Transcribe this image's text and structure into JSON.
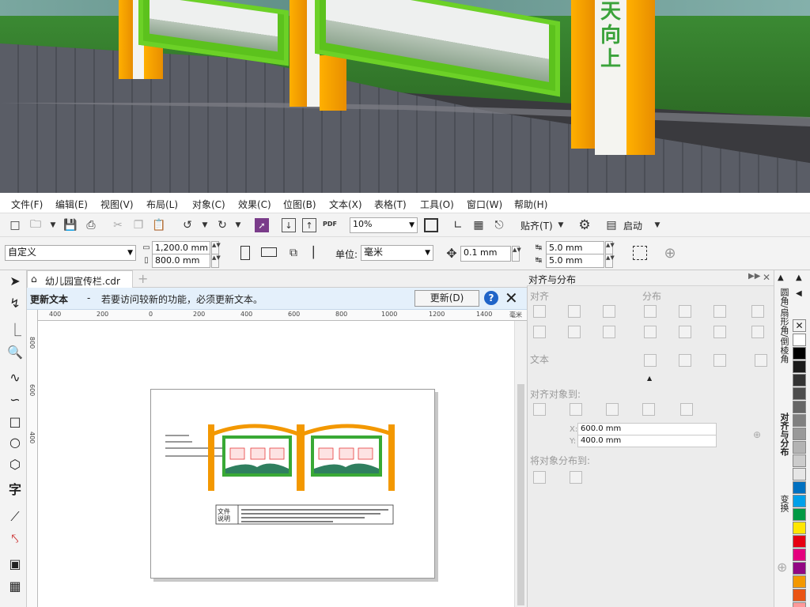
{
  "render": {
    "pillar_text": [
      "天",
      "向",
      "上"
    ]
  },
  "menu": [
    "文件(F)",
    "编辑(E)",
    "视图(V)",
    "布局(L)",
    "对象(C)",
    "效果(C)",
    "位图(B)",
    "文本(X)",
    "表格(T)",
    "工具(O)",
    "窗口(W)",
    "帮助(H)"
  ],
  "toolbar": {
    "zoom": "10%",
    "snap_label": "贴齐(T)",
    "launch_label": "启动",
    "pdf_label": "PDF"
  },
  "propbar": {
    "page_size": "自定义",
    "width": "1,200.0 mm",
    "height": "800.0 mm",
    "units_label": "单位:",
    "units": "毫米",
    "nudge": "0.1 mm",
    "dup_x": "5.0 mm",
    "dup_y": "5.0 mm"
  },
  "document": {
    "tab_title": "幼儿园宣传栏.cdr",
    "notice_title": "更新文本",
    "notice_dash": "-",
    "notice_text": "若要访问较新的功能，必须更新文本。",
    "notice_button": "更新(D)"
  },
  "ruler_h": [
    "400",
    "200",
    "0",
    "200",
    "400",
    "600",
    "800",
    "1000",
    "1200",
    "1400",
    "毫米"
  ],
  "ruler_v": [
    "800",
    "600",
    "400"
  ],
  "drawing": {
    "note_label": "文件\n说明"
  },
  "docker": {
    "title": "对齐与分布",
    "section_align": "对齐",
    "section_distribute": "分布",
    "section_text": "文本",
    "align_to_label": "对齐对象到:",
    "x_label": "X:",
    "x_value": "600.0 mm",
    "y_label": "Y:",
    "y_value": "400.0 mm",
    "distribute_to_label": "将对象分布到:"
  },
  "side_tabs": [
    "圆角/扇形角/倒棱角",
    "对齐与分布",
    "变换"
  ],
  "palette": [
    "#ffffff",
    "#000000",
    "#1a1a1a",
    "#333333",
    "#4d4d4d",
    "#666666",
    "#808080",
    "#999999",
    "#b3b3b3",
    "#cccccc",
    "#e6e6e6",
    "#0070c0",
    "#00a0e9",
    "#009944",
    "#ffe600",
    "#e60012",
    "#e4007f",
    "#920783",
    "#f39800",
    "#ea5514",
    "#ff9999"
  ]
}
